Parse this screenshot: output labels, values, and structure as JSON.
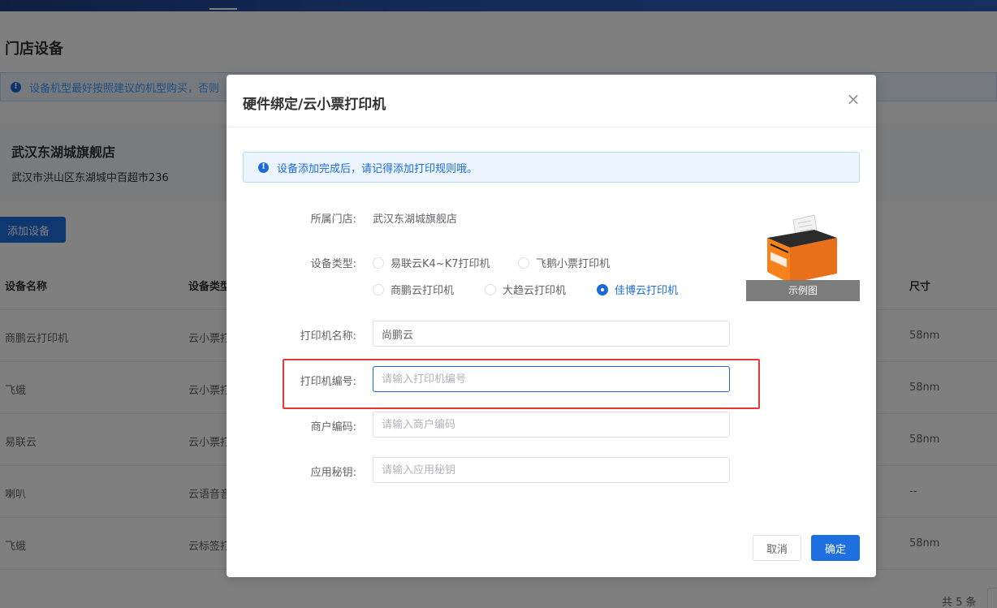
{
  "background": {
    "page_title": "门店设备",
    "notice_text": "设备机型最好按照建议的机型购买，否则",
    "store": {
      "name": "武汉东湖城旗舰店",
      "address": "武汉市洪山区东湖城中百超市236"
    },
    "add_button": "添加设备",
    "table": {
      "headers": [
        "设备名称",
        "设备类型",
        "尺寸"
      ],
      "rows": [
        [
          "商鹏云打印机",
          "云小票打",
          "58nm"
        ],
        [
          "飞蛾",
          "云小票打",
          "58nm"
        ],
        [
          "易联云",
          "云小票打",
          "58nm"
        ],
        [
          "喇叭",
          "云语音音",
          "--"
        ],
        [
          "飞蛾",
          "云标签打",
          "58nm"
        ]
      ],
      "total": "共 5 条"
    }
  },
  "dialog": {
    "title": "硬件绑定/云小票打印机",
    "alert": "设备添加完成后，请记得添加打印规则哦。",
    "store_label": "所属门店:",
    "store_value": "武汉东湖城旗舰店",
    "type_label": "设备类型:",
    "type_options": [
      "易联云K4~K7打印机",
      "飞鹅小票打印机",
      "商鹏云打印机",
      "大趋云打印机",
      "佳博云打印机"
    ],
    "type_selected": "佳博云打印机",
    "example_caption": "示例图",
    "printer_name_label": "打印机名称:",
    "printer_name_value": "尚鹏云",
    "printer_no_label": "打印机编号:",
    "printer_no_placeholder": "请输入打印机编号",
    "merchant_code_label": "商户编码:",
    "merchant_code_placeholder": "请输入商户编码",
    "app_secret_label": "应用秘钥:",
    "app_secret_placeholder": "请输入应用秘钥",
    "cancel": "取消",
    "confirm": "确定"
  },
  "colors": {
    "primary": "#1e6fe0",
    "highlight": "#e53935",
    "printer_body": "#f7821b"
  }
}
